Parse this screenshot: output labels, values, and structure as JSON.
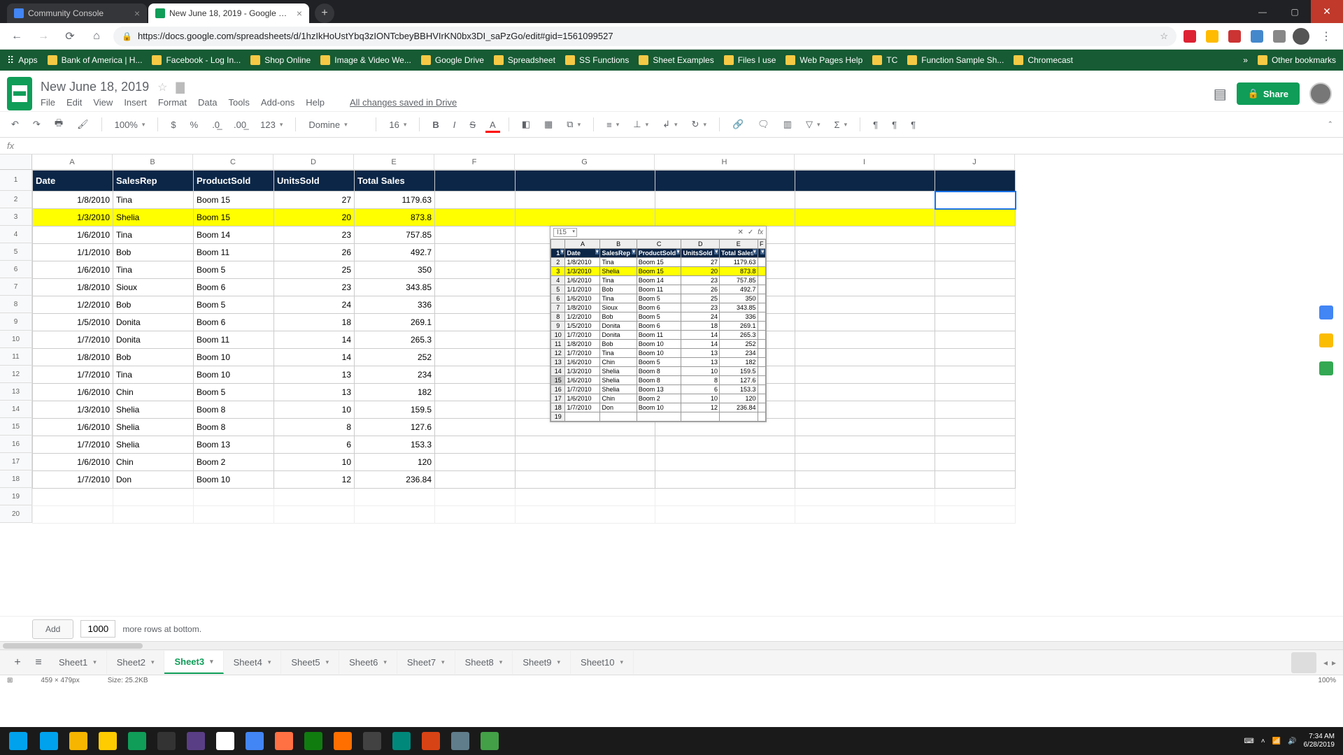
{
  "window": {
    "title": "New June 18, 2019 - Google Sheets - Google Chrome"
  },
  "tabs": [
    {
      "title": "Community Console",
      "active": false,
      "fav": "#4285f4"
    },
    {
      "title": "New June 18, 2019 - Google She…",
      "active": true,
      "fav": "#0f9d58"
    }
  ],
  "address": {
    "url": "https://docs.google.com/spreadsheets/d/1hzIkHoUstYbq3zIONTcbeyBBHVIrKN0bx3DI_saPzGo/edit#gid=1561099527"
  },
  "bookmarks": [
    "Apps",
    "Bank of America | H...",
    "Facebook - Log In...",
    "Shop Online",
    "Image & Video We...",
    "Google Drive",
    "Spreadsheet",
    "SS Functions",
    "Sheet Examples",
    "Files I use",
    "Web Pages Help",
    "TC",
    "Function Sample Sh...",
    "Chromecast"
  ],
  "bookmarks_overflow": "»",
  "bookmarks_other": "Other bookmarks",
  "doc": {
    "title": "New June 18, 2019",
    "menus": [
      "File",
      "Edit",
      "View",
      "Insert",
      "Format",
      "Data",
      "Tools",
      "Add-ons",
      "Help"
    ],
    "saved": "All changes saved in Drive",
    "share": "Share"
  },
  "toolbar": {
    "zoom": "100%",
    "currency": "$",
    "percent": "%",
    "dec_dec": ".0",
    "dec_inc": ".00",
    "numfmt": "123",
    "font": "Domine",
    "size": "16"
  },
  "fx_label": "fx",
  "columns": [
    "A",
    "B",
    "C",
    "D",
    "E",
    "F",
    "G",
    "H",
    "I",
    "J"
  ],
  "row_numbers": [
    1,
    2,
    3,
    4,
    5,
    6,
    7,
    8,
    9,
    10,
    11,
    12,
    13,
    14,
    15,
    16,
    17,
    18,
    19,
    20
  ],
  "headers": [
    "Date",
    "SalesRep",
    "ProductSold",
    "UnitsSold",
    "Total Sales"
  ],
  "rows": [
    {
      "date": "1/8/2010",
      "rep": "Tina",
      "prod": "Boom 15",
      "units": 27,
      "total": "1179.63"
    },
    {
      "date": "1/3/2010",
      "rep": "Shelia",
      "prod": "Boom 15",
      "units": 20,
      "total": "873.8",
      "hl": true
    },
    {
      "date": "1/6/2010",
      "rep": "Tina",
      "prod": "Boom 14",
      "units": 23,
      "total": "757.85"
    },
    {
      "date": "1/1/2010",
      "rep": "Bob",
      "prod": "Boom 11",
      "units": 26,
      "total": "492.7"
    },
    {
      "date": "1/6/2010",
      "rep": "Tina",
      "prod": "Boom 5",
      "units": 25,
      "total": "350"
    },
    {
      "date": "1/8/2010",
      "rep": "Sioux",
      "prod": "Boom 6",
      "units": 23,
      "total": "343.85"
    },
    {
      "date": "1/2/2010",
      "rep": "Bob",
      "prod": "Boom 5",
      "units": 24,
      "total": "336"
    },
    {
      "date": "1/5/2010",
      "rep": "Donita",
      "prod": "Boom 6",
      "units": 18,
      "total": "269.1"
    },
    {
      "date": "1/7/2010",
      "rep": "Donita",
      "prod": "Boom 11",
      "units": 14,
      "total": "265.3"
    },
    {
      "date": "1/8/2010",
      "rep": "Bob",
      "prod": "Boom 10",
      "units": 14,
      "total": "252"
    },
    {
      "date": "1/7/2010",
      "rep": "Tina",
      "prod": "Boom 10",
      "units": 13,
      "total": "234"
    },
    {
      "date": "1/6/2010",
      "rep": "Chin",
      "prod": "Boom 5",
      "units": 13,
      "total": "182"
    },
    {
      "date": "1/3/2010",
      "rep": "Shelia",
      "prod": "Boom 8",
      "units": 10,
      "total": "159.5"
    },
    {
      "date": "1/6/2010",
      "rep": "Shelia",
      "prod": "Boom 8",
      "units": 8,
      "total": "127.6"
    },
    {
      "date": "1/7/2010",
      "rep": "Shelia",
      "prod": "Boom 13",
      "units": 6,
      "total": "153.3"
    },
    {
      "date": "1/6/2010",
      "rep": "Chin",
      "prod": "Boom 2",
      "units": 10,
      "total": "120"
    },
    {
      "date": "1/7/2010",
      "rep": "Don",
      "prod": "Boom 10",
      "units": 12,
      "total": "236.84"
    }
  ],
  "embed": {
    "namebox": "I15",
    "cols": [
      "",
      "A",
      "B",
      "C",
      "D",
      "E",
      "F"
    ],
    "headers": [
      "Date",
      "SalesRep",
      "ProductSold",
      "UnitsSold",
      "Total Sales"
    ],
    "selected_row": 15,
    "hl_row": 3
  },
  "addrows": {
    "btn": "Add",
    "count": "1000",
    "text": "more rows at bottom."
  },
  "sheets": [
    "Sheet1",
    "Sheet2",
    "Sheet3",
    "Sheet4",
    "Sheet5",
    "Sheet6",
    "Sheet7",
    "Sheet8",
    "Sheet9",
    "Sheet10"
  ],
  "active_sheet": 2,
  "statusbar": {
    "dims": "459 × 479px",
    "size": "Size: 25.2KB",
    "zoom": "100%"
  },
  "tray": {
    "time": "7:34 AM",
    "date": "6/28/2019"
  },
  "task_colors": [
    "#00a2ed",
    "#f7b500",
    "#ffcc00",
    "#0f9d58",
    "#333333",
    "#5a3e85",
    "#ffffff",
    "#4285f4",
    "#ff7043",
    "#107c10",
    "#ff6f00",
    "#424242",
    "#00897b",
    "#d84315",
    "#607d8b",
    "#43a047"
  ]
}
